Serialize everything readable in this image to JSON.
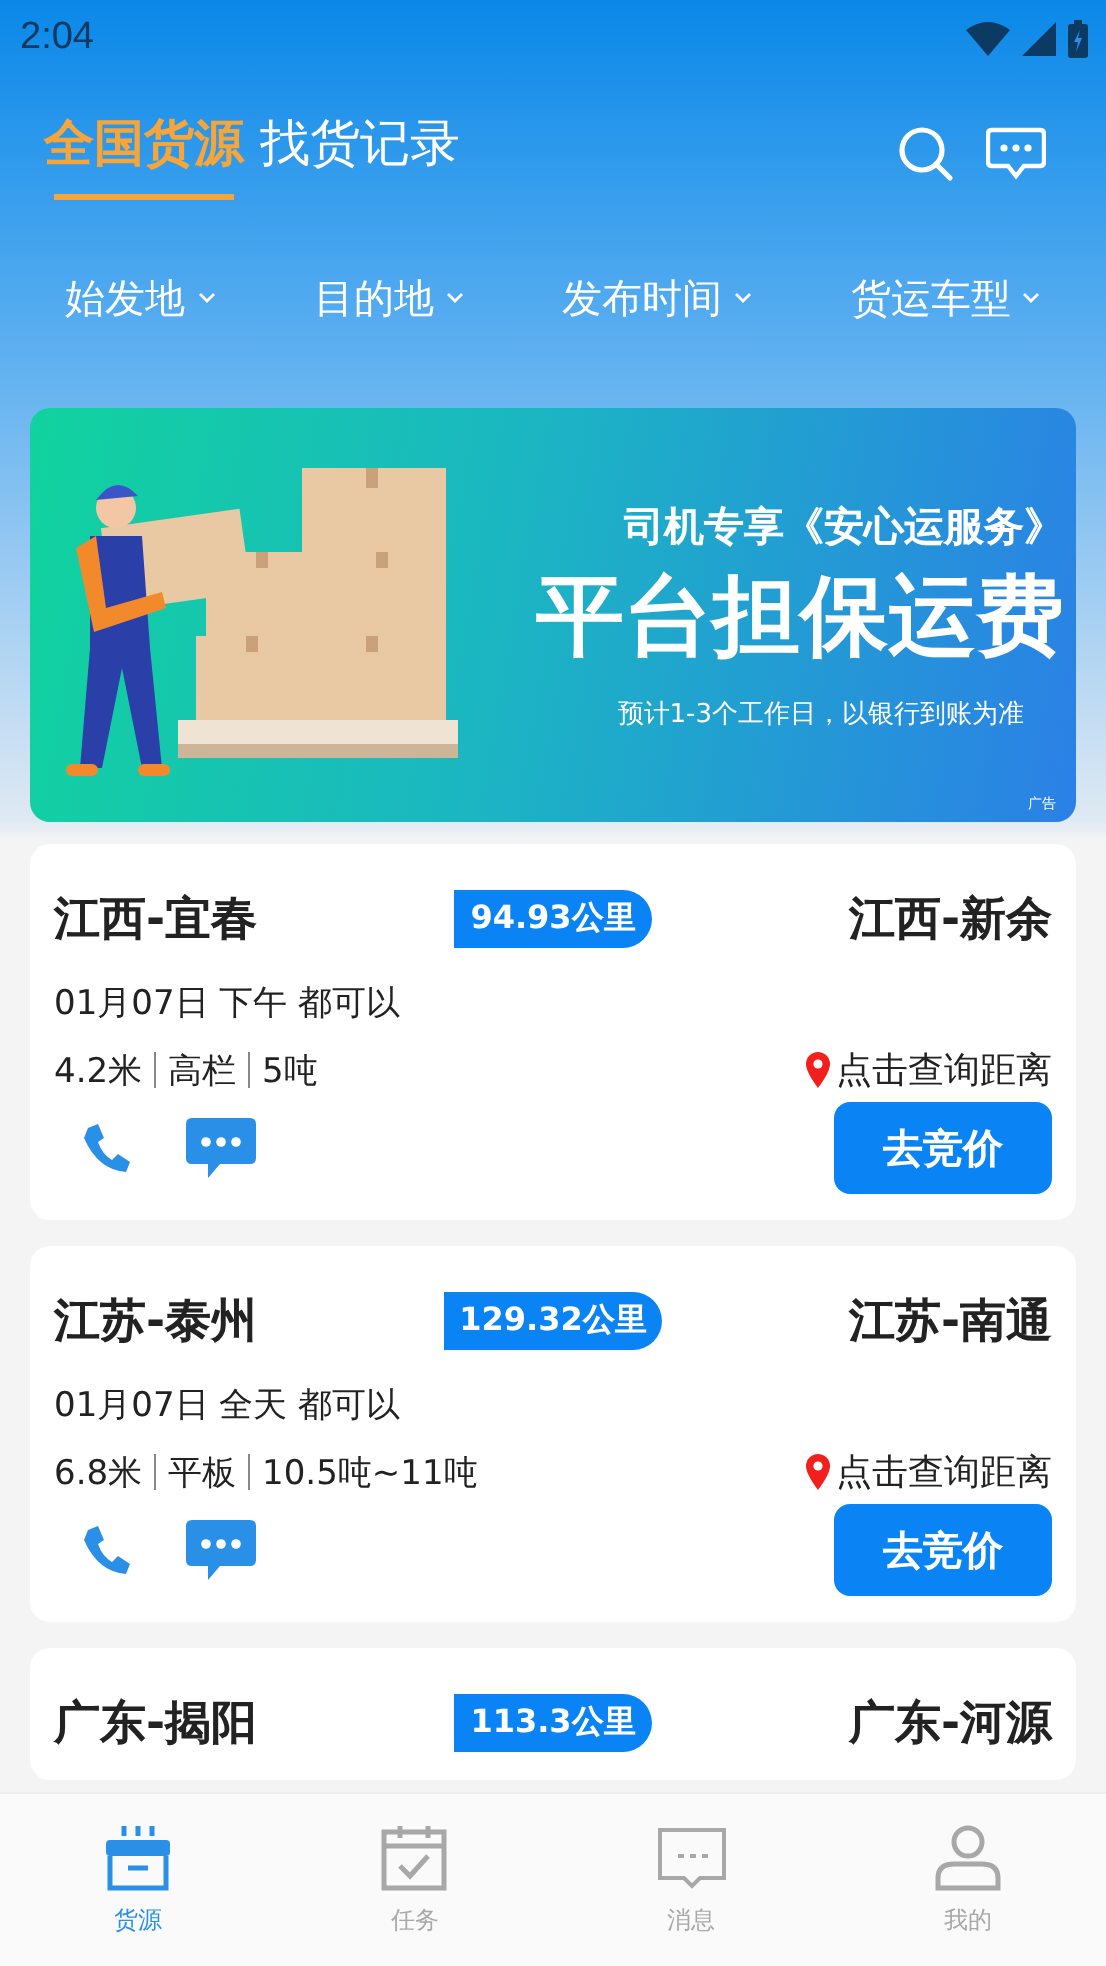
{
  "status_bar": {
    "time": "2:04"
  },
  "header_tabs": [
    {
      "label": "全国货源",
      "selected": true
    },
    {
      "label": "找货记录",
      "selected": false
    }
  ],
  "filters": [
    {
      "label": "始发地"
    },
    {
      "label": "目的地"
    },
    {
      "label": "发布时间"
    },
    {
      "label": "货运车型"
    }
  ],
  "banner": {
    "subtitle": "司机专享《安心运服务》",
    "headline": "平台担保运费",
    "note": "预计1-3个工作日，以银行到账为准",
    "ad_label": "广告"
  },
  "cargo_list": [
    {
      "origin": "江西-宜春",
      "distance": "94.93公里",
      "destination": "江西-新余",
      "schedule": "01月07日 下午 都可以",
      "specs": [
        "4.2米",
        "高栏",
        "5吨"
      ],
      "locate": "点击查询距离",
      "action": "去竞价"
    },
    {
      "origin": "江苏-泰州",
      "distance": "129.32公里",
      "destination": "江苏-南通",
      "schedule": "01月07日 全天 都可以",
      "specs": [
        "6.8米",
        "平板",
        "10.5吨~11吨"
      ],
      "locate": "点击查询距离",
      "action": "去竞价"
    },
    {
      "origin": "广东-揭阳",
      "distance": "113.3公里",
      "destination": "广东-河源"
    }
  ],
  "bottom_nav": [
    {
      "label": "货源",
      "kind": "cargo",
      "selected": true
    },
    {
      "label": "任务",
      "kind": "task",
      "selected": false
    },
    {
      "label": "消息",
      "kind": "message",
      "selected": false
    },
    {
      "label": "我的",
      "kind": "profile",
      "selected": false
    }
  ]
}
